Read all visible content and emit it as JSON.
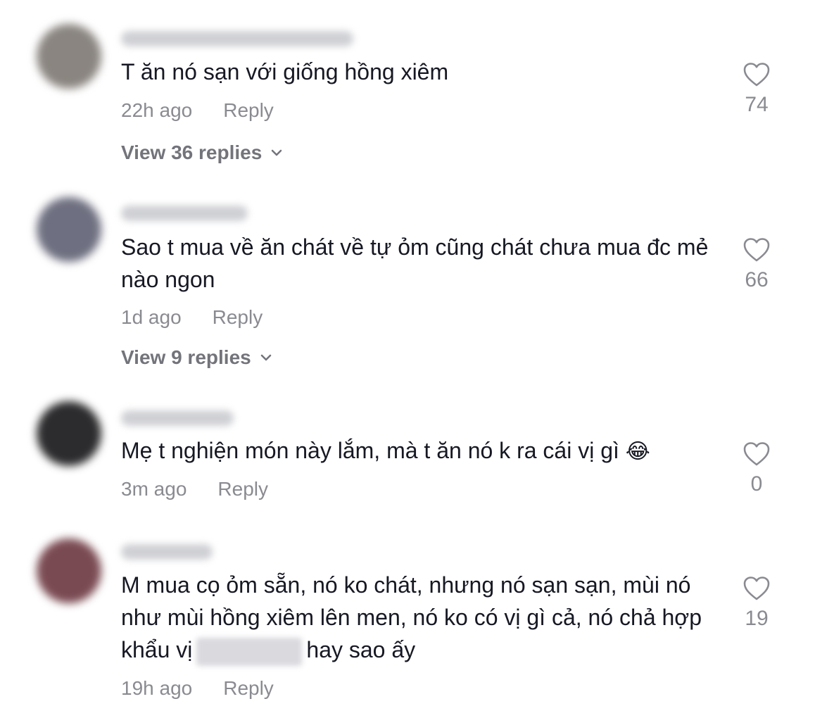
{
  "comments": [
    {
      "text": "T ăn nó sạn với giống hồng xiêm",
      "time": "22h ago",
      "reply": "Reply",
      "view_replies": "View 36 replies",
      "likes": "74",
      "avatar_color": "#8a8580"
    },
    {
      "text": "Sao t mua về ăn chát về tự ỏm cũng chát chưa mua đc mẻ nào ngon",
      "time": "1d ago",
      "reply": "Reply",
      "view_replies": "View 9 replies",
      "likes": "66",
      "avatar_color": "#6e6f80"
    },
    {
      "text": "Mẹ t nghiện món này lắm, mà t ăn nó k ra cái vị gì",
      "emoji": "😂",
      "time": "3m ago",
      "reply": "Reply",
      "likes": "0",
      "avatar_color": "#2c2c2e"
    },
    {
      "text_before": "M mua cọ ỏm sẵn, nó ko chát, nhưng nó sạn sạn, mùi nó như mùi hồng xiêm lên men, nó ko có vị gì cả, nó chả hợp khẩu vị",
      "text_after": "hay sao ấy",
      "time": "19h ago",
      "reply": "Reply",
      "likes": "19",
      "avatar_color": "#7a4a52"
    }
  ]
}
